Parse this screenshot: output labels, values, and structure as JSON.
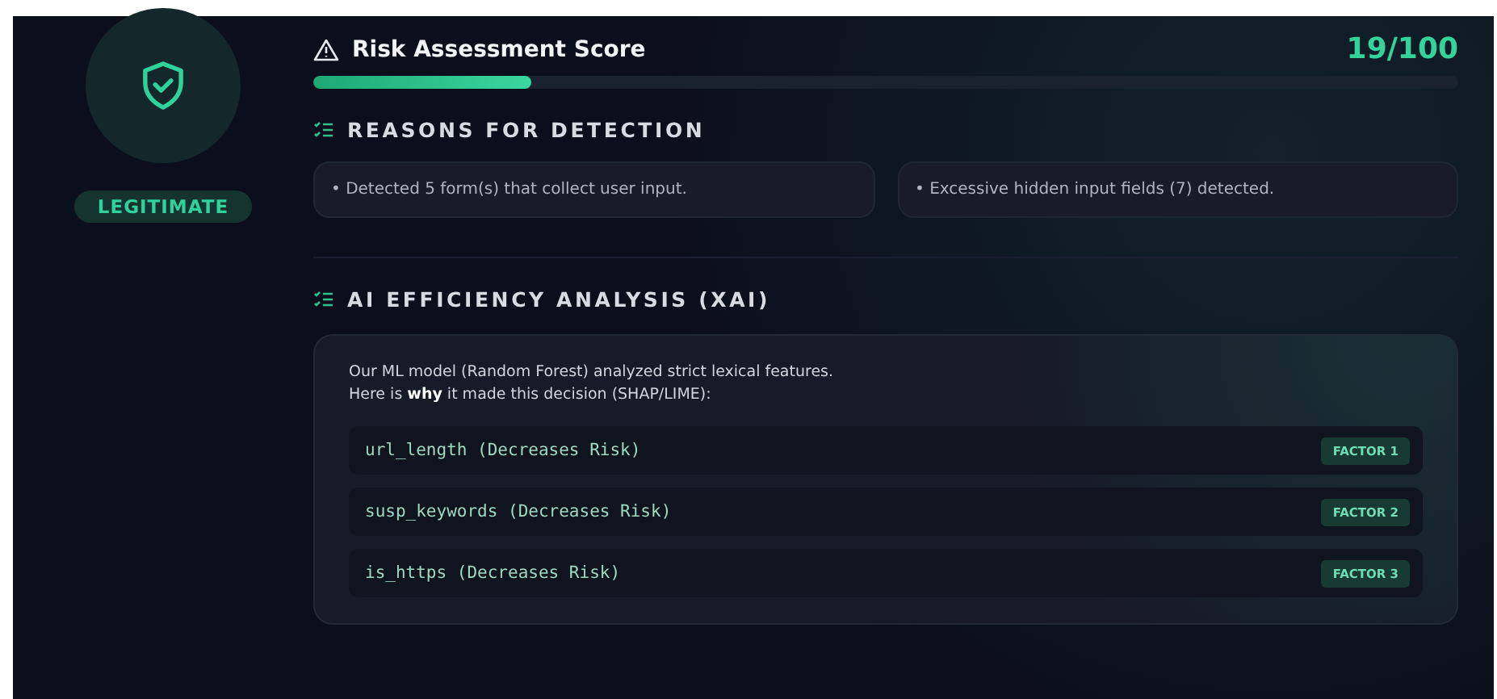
{
  "verdict": {
    "label": "LEGITIMATE"
  },
  "risk": {
    "title": "Risk Assessment Score",
    "score": "19/100",
    "level": 0.19
  },
  "reasons": {
    "heading": "REASONS FOR DETECTION",
    "items": [
      "• Detected 5 form(s) that collect user input.",
      "• Excessive hidden input fields (7) detected."
    ]
  },
  "xai": {
    "heading": "AI EFFICIENCY ANALYSIS (XAI)",
    "intro": [
      "Our ML model (Random Forest) analyzed strict lexical features.",
      "Here is **why** it made this decision (SHAP/LIME):"
    ],
    "factors": [
      {
        "feature": "url_length (Decreases Risk)",
        "tag": "FACTOR 1"
      },
      {
        "feature": "susp_keywords (Decreases Risk)",
        "tag": "FACTOR 2"
      },
      {
        "feature": "is_https (Decreases Risk)",
        "tag": "FACTOR 3"
      }
    ]
  }
}
